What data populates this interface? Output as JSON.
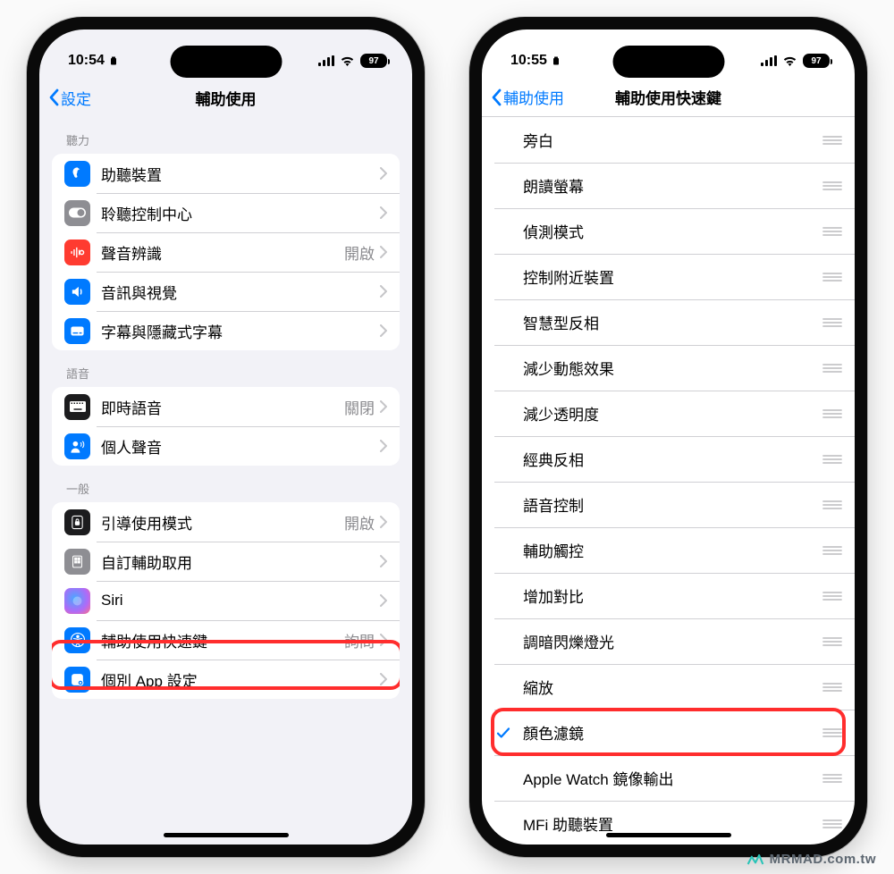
{
  "left_phone": {
    "status": {
      "time": "10:54",
      "battery": "97"
    },
    "nav": {
      "back": "設定",
      "title": "輔助使用"
    },
    "sections": [
      {
        "header": "聽力",
        "rows": [
          {
            "label": "助聽裝置"
          },
          {
            "label": "聆聽控制中心"
          },
          {
            "label": "聲音辨識",
            "value": "開啟"
          },
          {
            "label": "音訊與視覺"
          },
          {
            "label": "字幕與隱藏式字幕"
          }
        ]
      },
      {
        "header": "語音",
        "rows": [
          {
            "label": "即時語音",
            "value": "關閉"
          },
          {
            "label": "個人聲音"
          }
        ]
      },
      {
        "header": "一般",
        "rows": [
          {
            "label": "引導使用模式",
            "value": "開啟"
          },
          {
            "label": "自訂輔助取用"
          },
          {
            "label": "Siri"
          },
          {
            "label": "輔助使用快速鍵",
            "value": "詢問"
          },
          {
            "label": "個別 App 設定"
          }
        ]
      }
    ]
  },
  "right_phone": {
    "status": {
      "time": "10:55",
      "battery": "97"
    },
    "nav": {
      "back": "輔助使用",
      "title": "輔助使用快速鍵"
    },
    "items": [
      {
        "label": "旁白",
        "checked": false
      },
      {
        "label": "朗讀螢幕",
        "checked": false
      },
      {
        "label": "偵測模式",
        "checked": false
      },
      {
        "label": "控制附近裝置",
        "checked": false
      },
      {
        "label": "智慧型反相",
        "checked": false
      },
      {
        "label": "減少動態效果",
        "checked": false
      },
      {
        "label": "減少透明度",
        "checked": false
      },
      {
        "label": "經典反相",
        "checked": false
      },
      {
        "label": "語音控制",
        "checked": false
      },
      {
        "label": "輔助觸控",
        "checked": false
      },
      {
        "label": "增加對比",
        "checked": false
      },
      {
        "label": "調暗閃爍燈光",
        "checked": false
      },
      {
        "label": "縮放",
        "checked": false
      },
      {
        "label": "顏色濾鏡",
        "checked": true
      },
      {
        "label": "Apple Watch 鏡像輸出",
        "checked": false
      },
      {
        "label": "MFi 助聽裝置",
        "checked": false
      }
    ]
  },
  "watermark": "MRMAD.com.tw"
}
